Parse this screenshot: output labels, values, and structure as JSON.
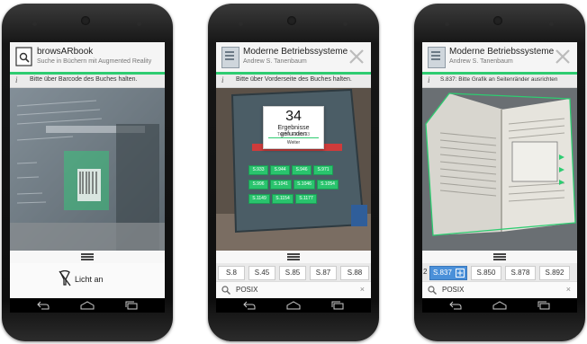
{
  "phones": [
    {
      "app_title": "browsARbook",
      "app_subtitle": "Suche in Büchern mit Augmented Reality",
      "info_glyph": "i",
      "info_text": "Bitte über Barcode des Buches halten.",
      "light_label": "Licht an"
    },
    {
      "app_title": "Moderne Betriebssysteme",
      "app_subtitle": "Andrew S. Tanenbaum",
      "info_glyph": "i",
      "info_text": "Bitte über Vorderseite des Buches halten.",
      "result_count": "34",
      "result_label": "Ergebnisse gefunden",
      "result_range": "Treffer 23 bis 33",
      "result_more": "Weiter",
      "tags": [
        "S.933",
        "S.944",
        "S.946",
        "S.971",
        "S.996",
        "S.1041",
        "S.1046",
        "S.1054",
        "S.1149",
        "S.1154",
        "S.1177"
      ],
      "chips": [
        "S.8",
        "S.45",
        "S.85",
        "S.87",
        "S.88"
      ],
      "search_query": "POSIX",
      "clear_glyph": "×"
    },
    {
      "app_title": "Moderne Betriebssysteme",
      "app_subtitle": "Andrew S. Tanenbaum",
      "info_glyph": "i",
      "info_text": "S.837: Bitte Grafik an Seitenränder ausrichten",
      "chip_lead": "2",
      "chips": [
        "S.837",
        "S.850",
        "S.878",
        "S.892"
      ],
      "search_query": "POSIX",
      "clear_glyph": "×"
    }
  ],
  "colors": {
    "accent_green": "#2ecc71",
    "selected_chip": "#4a90d9"
  }
}
